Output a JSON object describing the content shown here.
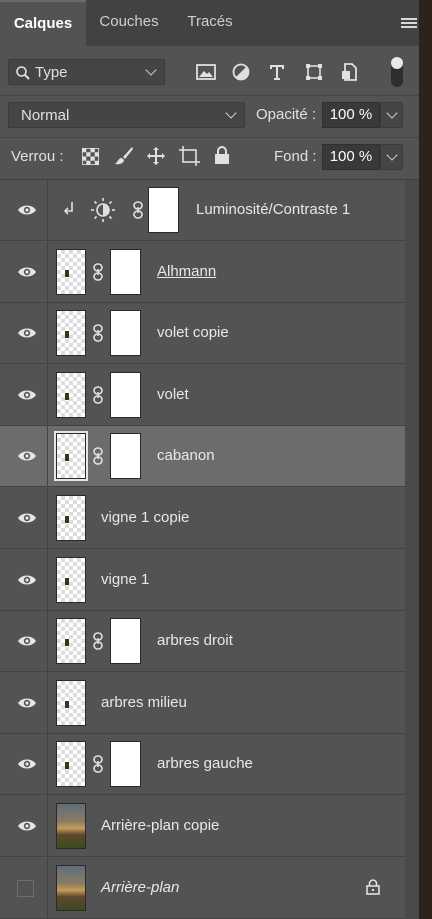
{
  "tabs": [
    {
      "label": "Calques",
      "active": true
    },
    {
      "label": "Couches",
      "active": false
    },
    {
      "label": "Tracés",
      "active": false
    }
  ],
  "filter": {
    "kind_value": "Type",
    "icons": [
      "image-filter-icon",
      "adjustment-filter-icon",
      "text-filter-icon",
      "shape-filter-icon",
      "smart-object-filter-icon"
    ]
  },
  "blend": {
    "mode": "Normal",
    "opacity_label": "Opacité :",
    "opacity_value": "100 %"
  },
  "lock": {
    "label": "Verrou :",
    "fill_label": "Fond :",
    "fill_value": "100 %",
    "icons": [
      "lock-transparency-icon",
      "lock-brush-icon",
      "lock-position-icon",
      "lock-artboard-icon",
      "lock-all-icon"
    ]
  },
  "layers": [
    {
      "name": "Luminosité/Contraste 1",
      "type": "adjustment",
      "visible": true
    },
    {
      "name": "Alhmann",
      "type": "masked",
      "visible": true,
      "underline": true
    },
    {
      "name": "volet copie",
      "type": "masked",
      "visible": true
    },
    {
      "name": "volet",
      "type": "masked",
      "visible": true
    },
    {
      "name": "cabanon",
      "type": "masked",
      "visible": true,
      "selected": true
    },
    {
      "name": "vigne 1 copie",
      "type": "pixel",
      "visible": true
    },
    {
      "name": "vigne 1",
      "type": "pixel",
      "visible": true
    },
    {
      "name": "arbres droit",
      "type": "masked",
      "visible": true
    },
    {
      "name": "arbres milieu",
      "type": "pixel",
      "visible": true
    },
    {
      "name": "arbres gauche",
      "type": "masked",
      "visible": true
    },
    {
      "name": "Arrière-plan copie",
      "type": "photo",
      "visible": true
    },
    {
      "name": "Arrière-plan",
      "type": "background",
      "visible": false,
      "italic": true,
      "locked": true
    }
  ],
  "colors": {
    "panel": "#535353",
    "tabbar": "#424242",
    "selected_row": "#6c6c6c"
  }
}
